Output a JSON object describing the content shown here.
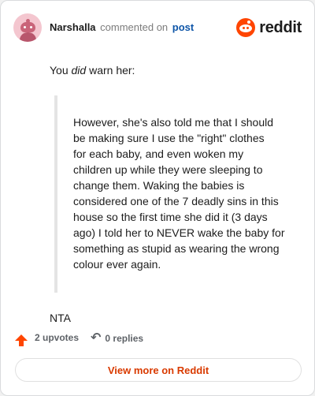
{
  "header": {
    "username": "Narshalla",
    "action_text": "commented on",
    "post_link": "post",
    "brand": "reddit"
  },
  "comment": {
    "intro_prefix": "You ",
    "intro_emphasis": "did",
    "intro_suffix": " warn her:",
    "quote_lines": [
      "However, she's also told me that I should",
      "be making sure I use the \"right\" clothes",
      "for each baby, and even woken my",
      "children up while they were sleeping to",
      "change them. Waking the babies is",
      "considered one of the 7 deadly sins in this",
      "house so the first time she did it (3 days",
      "ago) I told her to NEVER wake the baby for",
      "something as stupid as wearing the wrong",
      "colour ever again."
    ],
    "verdict": "NTA"
  },
  "footer": {
    "upvotes": "2 upvotes",
    "replies": "0 replies",
    "view_more": "View more on Reddit"
  },
  "colors": {
    "brand_orange": "#ff4500",
    "link_blue": "#0f56a8",
    "cta_text": "#d93a00"
  },
  "icons": {
    "avatar": "snoo-avatar",
    "brand": "reddit-logo-icon",
    "upvote": "upvote-arrow-icon",
    "reply": "reply-arrow-icon"
  }
}
